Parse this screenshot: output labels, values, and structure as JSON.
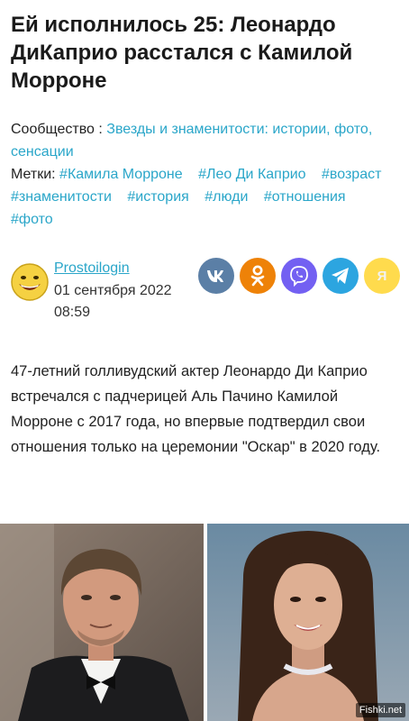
{
  "article": {
    "title": "Ей исполнилось 25: Леонардо ДиКаприо расстался с Камилой Морроне",
    "community_label": "Сообщество :",
    "community_link": "Звезды и знаменитости: истории, фото, сенсации",
    "tags_label": "Метки:",
    "tags": [
      "#Камила Морроне",
      "#Лео Ди Каприо",
      "#возраст",
      "#знаменитости",
      "#история",
      "#люди",
      "#отношения",
      "#фото"
    ],
    "author": "Prostoilogin",
    "date": "01 сентября 2022 08:59",
    "body": "47-летний голливудский актер Леонардо Ди Каприо встречался с падчерицей Аль Пачино Камилой Морроне с 2017 года, но впервые подтвердил свои отношения только на церемонии \"Оскар\" в 2020 году.",
    "watermark": "Fishki.net"
  },
  "share_buttons": [
    {
      "name": "vk",
      "label": "VK",
      "color": "#5b7fa6",
      "icon": "vk-icon"
    },
    {
      "name": "odnoklassniki",
      "label": "OK",
      "color": "#ee8208",
      "icon": "ok-icon"
    },
    {
      "name": "viber",
      "label": "Viber",
      "color": "#7360f2",
      "icon": "viber-icon"
    },
    {
      "name": "telegram",
      "label": "Telegram",
      "color": "#2ca5e0",
      "icon": "telegram-icon"
    },
    {
      "name": "yandex",
      "label": "Я",
      "color": "#ffdb4d",
      "icon": "yandex-icon"
    }
  ]
}
